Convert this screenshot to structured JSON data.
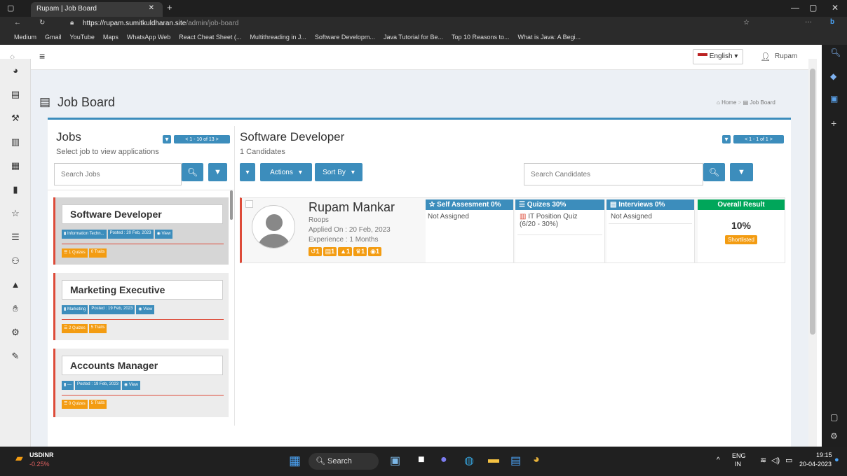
{
  "browser": {
    "tab_title": "Rupam | Job Board",
    "url_host": "https://rupam.sumitkuldharan.site",
    "url_path": "/admin/job-board",
    "bookmarks": [
      "Medium",
      "Gmail",
      "YouTube",
      "Maps",
      "WhatsApp Web",
      "React Cheat Sheet (...",
      "Multithreading in J...",
      "Software Developm...",
      "Java Tutorial for Be...",
      "Top 10 Reasons to...",
      "What is Java: A Begi..."
    ]
  },
  "header": {
    "language": "English ▾",
    "user": "Rupam"
  },
  "page": {
    "title": "Job Board",
    "breadcrumb_home": "Home",
    "breadcrumb_current": "Job Board"
  },
  "jobs_panel": {
    "title": "Jobs",
    "subtitle": "Select job to view applications",
    "pager": "1 - 10 of 13",
    "search_placeholder": "Search Jobs",
    "jobs": [
      {
        "title": "Software Developer",
        "category": "Information Techn...",
        "posted": "Posted : 20 Feb, 2023",
        "view": "View",
        "quizzes": "1 Quizes",
        "traits": "0 Traits"
      },
      {
        "title": "Marketing Executive",
        "category": "Marketing",
        "posted": "Posted : 19 Feb, 2023",
        "view": "View",
        "quizzes": "2 Quizes",
        "traits": "5 Traits"
      },
      {
        "title": "Accounts Manager",
        "category": "—",
        "posted": "Posted : 19 Feb, 2023",
        "view": "View",
        "quizzes": "0 Quizes",
        "traits": "5 Traits"
      }
    ]
  },
  "candidates_panel": {
    "title": "Software Developer",
    "subtitle": "1 Candidates",
    "pager": "1 - 1 of 1",
    "actions_label": "Actions",
    "sort_label": "Sort By",
    "search_placeholder": "Search Candidates",
    "candidate": {
      "name": "Rupam Mankar",
      "username": "Roops",
      "applied": "Applied On : 20 Feb, 2023",
      "experience": "Experience : 1 Months",
      "badges": [
        "1",
        "1",
        "1",
        "1",
        "1"
      ],
      "self_assessment_header": "Self Assesment 0%",
      "self_assessment_value": "Not Assigned",
      "quizzes_header": "Quizes 30%",
      "quiz_name": "IT Position Quiz",
      "quiz_score": "(6/20 - 30%)",
      "interviews_header": "Interviews 0%",
      "interviews_value": "Not Assigned",
      "overall_header": "Overall Result",
      "overall_value": "10%",
      "status": "Shortlisted"
    }
  },
  "taskbar": {
    "ticker": "USDINR",
    "ticker_change": "-0.25%",
    "search": "Search",
    "lang": "ENG",
    "region": "IN",
    "time": "19:15",
    "date": "20-04-2023"
  },
  "colors": {
    "primary": "#3c8dbc",
    "danger": "#dd4b39",
    "warning": "#f39c12",
    "success": "#00a65a"
  }
}
